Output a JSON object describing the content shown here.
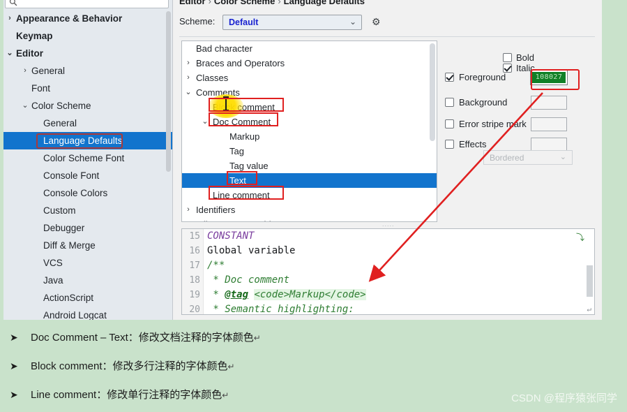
{
  "app": {
    "background_color": "#c9e2cb",
    "dialog_background": "#f1f1f1",
    "accent_selection": "#1274cd",
    "annotation_red": "#e02020",
    "highlight_yellow": "#ffdd00"
  },
  "sidebar": {
    "search": {
      "placeholder": "",
      "value": "",
      "icon": "search-icon"
    },
    "items": [
      {
        "label": "Appearance & Behavior",
        "arrow": "›",
        "indent": 18,
        "bold": true,
        "selected": false
      },
      {
        "label": "Keymap",
        "arrow": "",
        "indent": 18,
        "bold": true,
        "selected": false
      },
      {
        "label": "Editor",
        "arrow": "⌄",
        "indent": 18,
        "bold": true,
        "selected": false
      },
      {
        "label": "General",
        "arrow": "›",
        "indent": 40,
        "bold": false,
        "selected": false
      },
      {
        "label": "Font",
        "arrow": "",
        "indent": 40,
        "bold": false,
        "selected": false
      },
      {
        "label": "Color Scheme",
        "arrow": "⌄",
        "indent": 40,
        "bold": false,
        "selected": false
      },
      {
        "label": "General",
        "arrow": "",
        "indent": 57,
        "bold": false,
        "selected": false
      },
      {
        "label": "Language Defaults",
        "arrow": "",
        "indent": 57,
        "bold": false,
        "selected": true
      },
      {
        "label": "Color Scheme Font",
        "arrow": "",
        "indent": 57,
        "bold": false,
        "selected": false
      },
      {
        "label": "Console Font",
        "arrow": "",
        "indent": 57,
        "bold": false,
        "selected": false
      },
      {
        "label": "Console Colors",
        "arrow": "",
        "indent": 57,
        "bold": false,
        "selected": false
      },
      {
        "label": "Custom",
        "arrow": "",
        "indent": 57,
        "bold": false,
        "selected": false
      },
      {
        "label": "Debugger",
        "arrow": "",
        "indent": 57,
        "bold": false,
        "selected": false
      },
      {
        "label": "Diff & Merge",
        "arrow": "",
        "indent": 57,
        "bold": false,
        "selected": false
      },
      {
        "label": "VCS",
        "arrow": "",
        "indent": 57,
        "bold": false,
        "selected": false
      },
      {
        "label": "Java",
        "arrow": "",
        "indent": 57,
        "bold": false,
        "selected": false
      },
      {
        "label": "ActionScript",
        "arrow": "",
        "indent": 57,
        "bold": false,
        "selected": false
      },
      {
        "label": "Android Logcat",
        "arrow": "",
        "indent": 57,
        "bold": false,
        "selected": false
      }
    ]
  },
  "content": {
    "breadcrumb": {
      "part1": "Editor",
      "part2": "Color Scheme",
      "part3": "Language Defaults",
      "separator": "›"
    },
    "scheme": {
      "label": "Scheme:",
      "value": "Default",
      "chevron": "⌄",
      "gear": "⚙"
    }
  },
  "attribute_tree": {
    "rows": [
      {
        "label": "Bad character",
        "arrow": "",
        "indent": 20,
        "selected": false,
        "boxed": false
      },
      {
        "label": "Braces and Operators",
        "arrow": "›",
        "indent": 20,
        "selected": false,
        "boxed": false
      },
      {
        "label": "Classes",
        "arrow": "›",
        "indent": 20,
        "selected": false,
        "boxed": false
      },
      {
        "label": "Comments",
        "arrow": "⌄",
        "indent": 20,
        "selected": false,
        "boxed": false
      },
      {
        "label": "Block comment",
        "arrow": "",
        "indent": 44,
        "selected": false,
        "boxed": true
      },
      {
        "label": "Doc Comment",
        "arrow": "⌄",
        "indent": 44,
        "selected": false,
        "boxed": true
      },
      {
        "label": "Markup",
        "arrow": "",
        "indent": 68,
        "selected": false,
        "boxed": false
      },
      {
        "label": "Tag",
        "arrow": "",
        "indent": 68,
        "selected": false,
        "boxed": false
      },
      {
        "label": "Tag value",
        "arrow": "",
        "indent": 68,
        "selected": false,
        "boxed": false
      },
      {
        "label": "Text",
        "arrow": "",
        "indent": 68,
        "selected": true,
        "boxed": true
      },
      {
        "label": "Line comment",
        "arrow": "",
        "indent": 44,
        "selected": false,
        "boxed": true
      },
      {
        "label": "Identifiers",
        "arrow": "›",
        "indent": 20,
        "selected": false,
        "boxed": false
      },
      {
        "label": "Inline parameter hint",
        "arrow": "",
        "indent": 20,
        "selected": false,
        "boxed": false
      }
    ]
  },
  "attributes": {
    "bold": {
      "label": "Bold",
      "checked": false
    },
    "italic": {
      "label": "Italic",
      "checked": true
    },
    "foreground": {
      "label": "Foreground",
      "checked": true,
      "color_hex": "108027",
      "swatch_color": "#108027"
    },
    "background": {
      "label": "Background",
      "checked": false,
      "color_hex": ""
    },
    "error_stripe": {
      "label": "Error stripe mark",
      "checked": false,
      "color_hex": ""
    },
    "effects": {
      "label": "Effects",
      "checked": false,
      "color_hex": ""
    },
    "effect_type": {
      "value": "Bordered",
      "chevron": "⌄",
      "disabled": true
    }
  },
  "preview": {
    "lines": [
      {
        "num": "15",
        "segments": [
          {
            "text": "CONSTANT",
            "style": "const"
          }
        ]
      },
      {
        "num": "16",
        "segments": [
          {
            "text": "Global variable",
            "style": "plain"
          }
        ]
      },
      {
        "num": "17",
        "segments": [
          {
            "text": "/**",
            "style": "comment"
          }
        ]
      },
      {
        "num": "18",
        "segments": [
          {
            "text": " * Doc comment",
            "style": "comment"
          }
        ]
      },
      {
        "num": "19",
        "segments": [
          {
            "text": " * ",
            "style": "comment"
          },
          {
            "text": "@tag",
            "style": "tag"
          },
          {
            "text": " ",
            "style": "comment"
          },
          {
            "text": "<code>Markup</code>",
            "style": "markup"
          }
        ]
      },
      {
        "num": "20",
        "segments": [
          {
            "text": " * Semantic highlighting:",
            "style": "comment"
          }
        ]
      }
    ],
    "fold_icon": "⤵",
    "pilcrow": "↵"
  },
  "notes": [
    {
      "bullet": "➤",
      "text": "Doc Comment – Text：修改文档注释的字体颜色",
      "cr": "↵"
    },
    {
      "bullet": "➤",
      "text": "Block comment：修改多行注释的字体颜色",
      "cr": "↵"
    },
    {
      "bullet": "➤",
      "text": "Line comment：修改单行注释的字体颜色",
      "cr": "↵"
    }
  ],
  "watermark": {
    "text": "CSDN @程序猿张同学"
  }
}
